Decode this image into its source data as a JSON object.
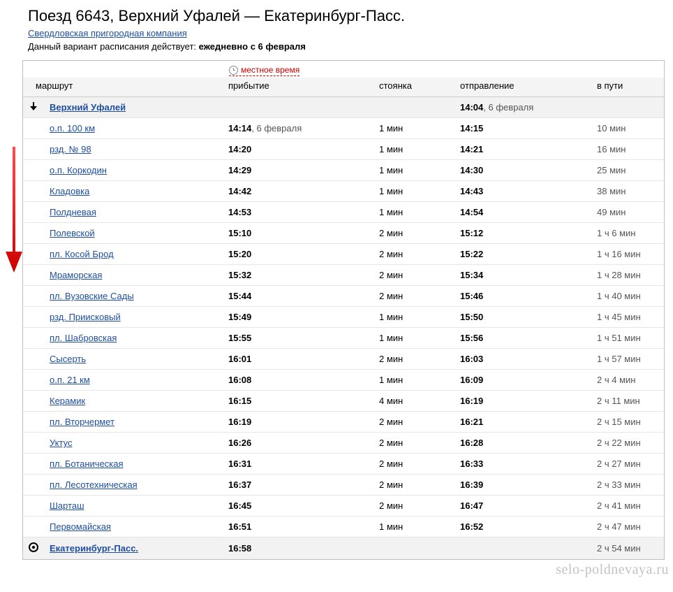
{
  "title": "Поезд 6643, Верхний Уфалей — Екатеринбург-Пасс.",
  "company": "Свердловская пригородная компания",
  "schedule_prefix": "Данный вариант расписания действует: ",
  "schedule_bold": "ежедневно с 6 февраля",
  "local_time_label": "местное время",
  "headers": {
    "route": "маршрут",
    "arrival": "прибытие",
    "stop": "стоянка",
    "departure": "отправление",
    "duration": "в пути"
  },
  "watermark": "selo-poldnevaya.ru",
  "rows": [
    {
      "station": "Верхний Уфалей",
      "arrival": "",
      "arr_date": "",
      "stop": "",
      "departure": "14:04",
      "dep_date": ", 6 февраля",
      "duration": "",
      "first": true
    },
    {
      "station": "о.п. 100 км",
      "arrival": "14:14",
      "arr_date": ", 6 февраля",
      "stop": "1 мин",
      "departure": "14:15",
      "dep_date": "",
      "duration": "10 мин"
    },
    {
      "station": "рзд. № 98",
      "arrival": "14:20",
      "arr_date": "",
      "stop": "1 мин",
      "departure": "14:21",
      "dep_date": "",
      "duration": "16 мин"
    },
    {
      "station": "о.п. Коркодин",
      "arrival": "14:29",
      "arr_date": "",
      "stop": "1 мин",
      "departure": "14:30",
      "dep_date": "",
      "duration": "25 мин"
    },
    {
      "station": "Кладовка",
      "arrival": "14:42",
      "arr_date": "",
      "stop": "1 мин",
      "departure": "14:43",
      "dep_date": "",
      "duration": "38 мин"
    },
    {
      "station": "Полдневая",
      "arrival": "14:53",
      "arr_date": "",
      "stop": "1 мин",
      "departure": "14:54",
      "dep_date": "",
      "duration": "49 мин"
    },
    {
      "station": "Полевской",
      "arrival": "15:10",
      "arr_date": "",
      "stop": "2 мин",
      "departure": "15:12",
      "dep_date": "",
      "duration": "1 ч 6 мин"
    },
    {
      "station": "пл. Косой Брод",
      "arrival": "15:20",
      "arr_date": "",
      "stop": "2 мин",
      "departure": "15:22",
      "dep_date": "",
      "duration": "1 ч 16 мин"
    },
    {
      "station": "Мраморская",
      "arrival": "15:32",
      "arr_date": "",
      "stop": "2 мин",
      "departure": "15:34",
      "dep_date": "",
      "duration": "1 ч 28 мин"
    },
    {
      "station": "пл. Вузовские Сады",
      "arrival": "15:44",
      "arr_date": "",
      "stop": "2 мин",
      "departure": "15:46",
      "dep_date": "",
      "duration": "1 ч 40 мин"
    },
    {
      "station": "рзд. Приисковый",
      "arrival": "15:49",
      "arr_date": "",
      "stop": "1 мин",
      "departure": "15:50",
      "dep_date": "",
      "duration": "1 ч 45 мин"
    },
    {
      "station": "пл. Шабровская",
      "arrival": "15:55",
      "arr_date": "",
      "stop": "1 мин",
      "departure": "15:56",
      "dep_date": "",
      "duration": "1 ч 51 мин"
    },
    {
      "station": "Сысерть",
      "arrival": "16:01",
      "arr_date": "",
      "stop": "2 мин",
      "departure": "16:03",
      "dep_date": "",
      "duration": "1 ч 57 мин"
    },
    {
      "station": "о.п. 21 км",
      "arrival": "16:08",
      "arr_date": "",
      "stop": "1 мин",
      "departure": "16:09",
      "dep_date": "",
      "duration": "2 ч 4 мин"
    },
    {
      "station": "Керамик",
      "arrival": "16:15",
      "arr_date": "",
      "stop": "4 мин",
      "departure": "16:19",
      "dep_date": "",
      "duration": "2 ч 11 мин"
    },
    {
      "station": "пл. Вторчермет",
      "arrival": "16:19",
      "arr_date": "",
      "stop": "2 мин",
      "departure": "16:21",
      "dep_date": "",
      "duration": "2 ч 15 мин"
    },
    {
      "station": "Уктус",
      "arrival": "16:26",
      "arr_date": "",
      "stop": "2 мин",
      "departure": "16:28",
      "dep_date": "",
      "duration": "2 ч 22 мин"
    },
    {
      "station": "пл. Ботаническая",
      "arrival": "16:31",
      "arr_date": "",
      "stop": "2 мин",
      "departure": "16:33",
      "dep_date": "",
      "duration": "2 ч 27 мин"
    },
    {
      "station": "пл. Лесотехническая",
      "arrival": "16:37",
      "arr_date": "",
      "stop": "2 мин",
      "departure": "16:39",
      "dep_date": "",
      "duration": "2 ч 33 мин"
    },
    {
      "station": "Шарташ",
      "arrival": "16:45",
      "arr_date": "",
      "stop": "2 мин",
      "departure": "16:47",
      "dep_date": "",
      "duration": "2 ч 41 мин"
    },
    {
      "station": "Первомайская",
      "arrival": "16:51",
      "arr_date": "",
      "stop": "1 мин",
      "departure": "16:52",
      "dep_date": "",
      "duration": "2 ч 47 мин"
    },
    {
      "station": "Екатеринбург-Пасс.",
      "arrival": "16:58",
      "arr_date": "",
      "stop": "",
      "departure": "",
      "dep_date": "",
      "duration": "2 ч 54 мин",
      "last": true
    }
  ]
}
